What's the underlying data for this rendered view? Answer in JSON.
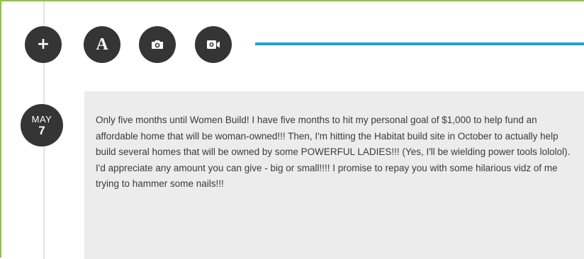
{
  "toolbar": {
    "buttons": [
      {
        "name": "add",
        "icon": "plus-icon"
      },
      {
        "name": "text",
        "icon": "text-a-icon",
        "glyph": "A"
      },
      {
        "name": "photo",
        "icon": "camera-icon"
      },
      {
        "name": "video",
        "icon": "video-camera-icon"
      }
    ],
    "plus_glyph": "+",
    "text_glyph": "A"
  },
  "colors": {
    "frame_border": "#8dc63f",
    "accent_line": "#1aa6d0",
    "button_bg": "#353535",
    "card_bg": "#ececec",
    "text": "#3a3a3a"
  },
  "post": {
    "date_month": "MAY",
    "date_day": "7",
    "text": "Only five months until Women Build! I have five months to hit my personal goal of $1,000 to help fund an affordable home that will be woman-owned!!! Then, I'm hitting the Habitat build site in October to actually help build several homes that will be owned by some POWERFUL LADIES!!! (Yes, I'll be wielding power tools lololol). I'd appreciate any amount you can give - big or small!!!! I promise to repay you with some hilarious vidz of me trying to hammer some nails!!!"
  }
}
